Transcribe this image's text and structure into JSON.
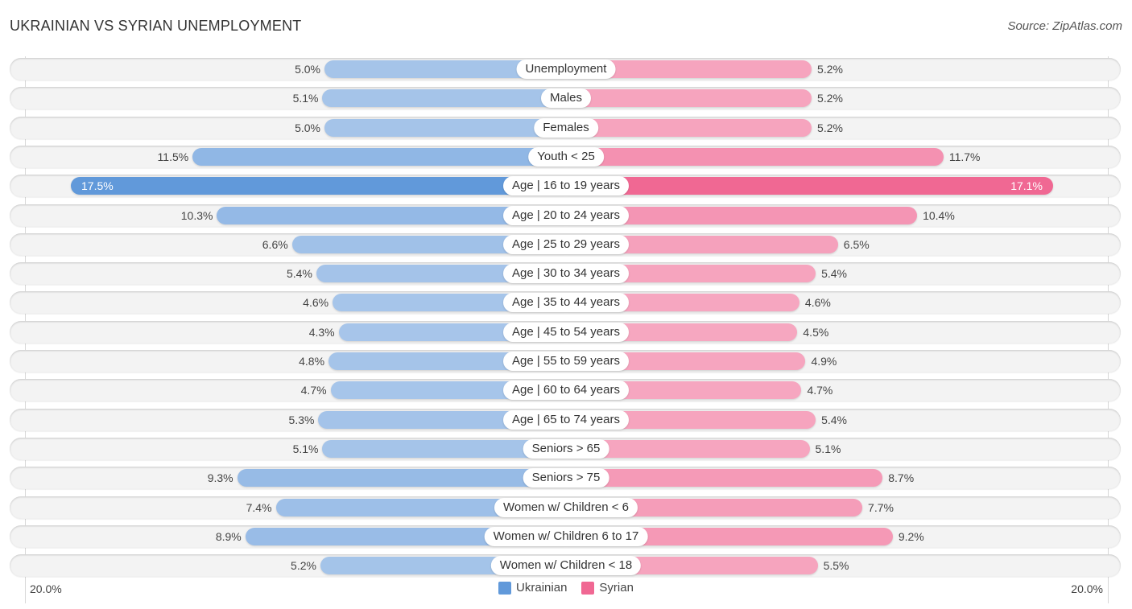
{
  "header": {
    "title": "UKRAINIAN VS SYRIAN UNEMPLOYMENT",
    "source": "Source: ZipAtlas.com"
  },
  "colors": {
    "ukrainian_light": "#a8c6ea",
    "ukrainian_strong": "#6199da",
    "syrian_light": "#f6a8c1",
    "syrian_strong": "#f06893"
  },
  "chart_data": {
    "type": "bar",
    "orientation": "horizontal-diverging",
    "title": "UKRAINIAN VS SYRIAN UNEMPLOYMENT",
    "xlabel": "",
    "ylabel": "",
    "xlim": [
      0,
      20.0
    ],
    "axis_labels": {
      "left": "20.0%",
      "right": "20.0%"
    },
    "legend": {
      "position": "bottom-center",
      "entries": [
        "Ukrainian",
        "Syrian"
      ]
    },
    "categories": [
      "Unemployment",
      "Males",
      "Females",
      "Youth < 25",
      "Age | 16 to 19 years",
      "Age | 20 to 24 years",
      "Age | 25 to 29 years",
      "Age | 30 to 34 years",
      "Age | 35 to 44 years",
      "Age | 45 to 54 years",
      "Age | 55 to 59 years",
      "Age | 60 to 64 years",
      "Age | 65 to 74 years",
      "Seniors > 65",
      "Seniors > 75",
      "Women w/ Children < 6",
      "Women w/ Children 6 to 17",
      "Women w/ Children < 18"
    ],
    "series": [
      {
        "name": "Ukrainian",
        "side": "left",
        "values": [
          5.0,
          5.1,
          5.0,
          11.5,
          17.5,
          10.3,
          6.6,
          5.4,
          4.6,
          4.3,
          4.8,
          4.7,
          5.3,
          5.1,
          9.3,
          7.4,
          8.9,
          5.2
        ]
      },
      {
        "name": "Syrian",
        "side": "right",
        "values": [
          5.2,
          5.2,
          5.2,
          11.7,
          17.1,
          10.4,
          6.5,
          5.4,
          4.6,
          4.5,
          4.9,
          4.7,
          5.4,
          5.1,
          8.7,
          7.7,
          9.2,
          5.5
        ]
      }
    ],
    "highlighted_category": "Age | 16 to 19 years",
    "value_suffix": "%"
  }
}
